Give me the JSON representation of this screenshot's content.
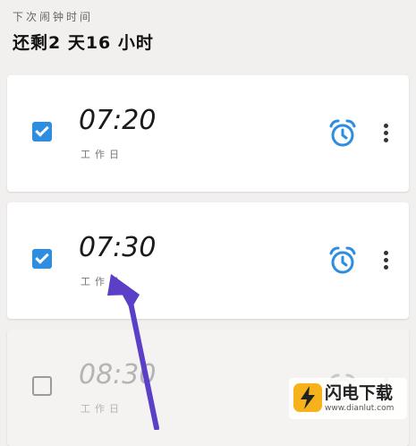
{
  "header": {
    "next_alarm_label": "下次闹钟时间",
    "remaining": "还剩2 天16 小时"
  },
  "alarms": [
    {
      "time": "07:20",
      "repeat": "工作日",
      "enabled": true
    },
    {
      "time": "07:30",
      "repeat": "工作日",
      "enabled": true
    },
    {
      "time": "08:30",
      "repeat": "工作日",
      "enabled": false
    }
  ],
  "colors": {
    "accent": "#2d8de0",
    "arrow": "#5b3fc6"
  },
  "icons": {
    "alarm": "alarm-clock-icon",
    "more": "more-vert-icon",
    "check": "check-icon"
  },
  "watermark": {
    "brand": "闪电下载",
    "url": "www.dianlut.com"
  }
}
